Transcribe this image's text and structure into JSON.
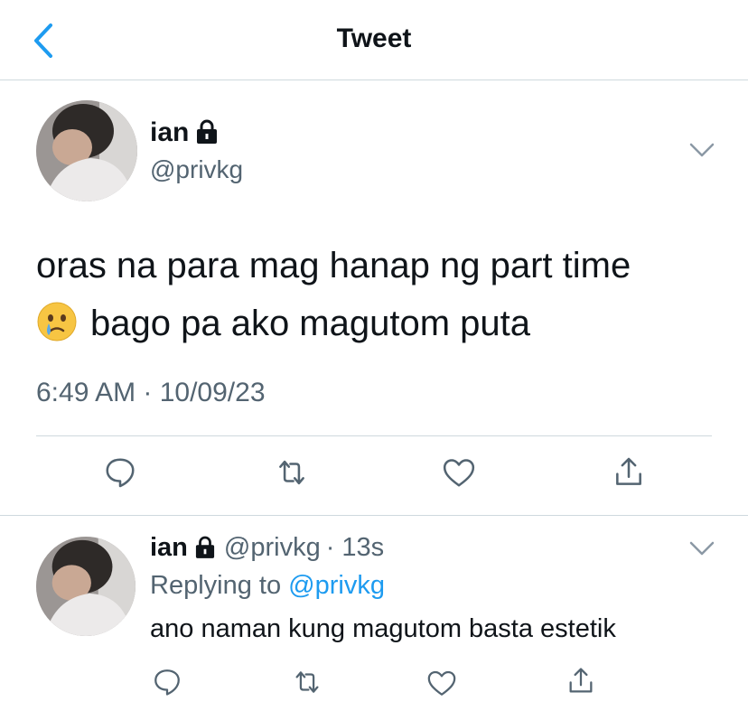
{
  "header": {
    "title": "Tweet"
  },
  "tweet": {
    "name": "ian",
    "handle": "@privkg",
    "text_line1": "oras na para mag hanap ng part time",
    "text_line2": "bago pa ako magutom puta",
    "timestamp": "6:49 AM · 10/09/23"
  },
  "reply": {
    "name": "ian",
    "handle": "@privkg",
    "age": "· 13s",
    "replying_label": "Replying to",
    "replying_handle": "@privkg",
    "text": "ano naman kung magutom basta estetik"
  },
  "icons": {
    "back": "chevron-left-icon",
    "lock": "lock-icon",
    "more": "chevron-down-icon",
    "reply": "reply-icon",
    "retweet": "retweet-icon",
    "like": "heart-icon",
    "share": "share-icon",
    "emoji": "crying-face-emoji"
  },
  "colors": {
    "accent": "#1d9bf0",
    "secondary_text": "#536471",
    "divider": "#cfd9de"
  }
}
